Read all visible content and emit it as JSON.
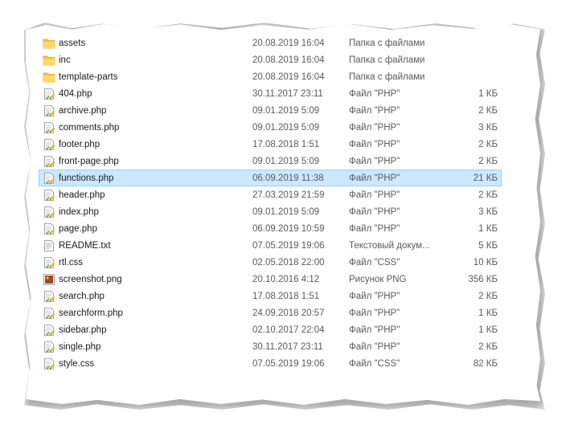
{
  "files": [
    {
      "name": "assets",
      "date": "20.08.2019 16:04",
      "type": "Папка с файлами",
      "size": "",
      "icon": "folder-icon"
    },
    {
      "name": "inc",
      "date": "20.08.2019 16:04",
      "type": "Папка с файлами",
      "size": "",
      "icon": "folder-icon"
    },
    {
      "name": "template-parts",
      "date": "20.08.2019 16:04",
      "type": "Папка с файлами",
      "size": "",
      "icon": "folder-icon"
    },
    {
      "name": "404.php",
      "date": "30.11.2017 23:11",
      "type": "Файл \"PHP\"",
      "size": "1 КБ",
      "icon": "php-file-icon"
    },
    {
      "name": "archive.php",
      "date": "09.01.2019 5:09",
      "type": "Файл \"PHP\"",
      "size": "2 КБ",
      "icon": "php-file-icon"
    },
    {
      "name": "comments.php",
      "date": "09.01.2019 5:09",
      "type": "Файл \"PHP\"",
      "size": "3 КБ",
      "icon": "php-file-icon"
    },
    {
      "name": "footer.php",
      "date": "17.08.2018 1:51",
      "type": "Файл \"PHP\"",
      "size": "2 КБ",
      "icon": "php-file-icon"
    },
    {
      "name": "front-page.php",
      "date": "09.01.2019 5:09",
      "type": "Файл \"PHP\"",
      "size": "2 КБ",
      "icon": "php-file-icon"
    },
    {
      "name": "functions.php",
      "date": "06.09.2019 11:38",
      "type": "Файл \"PHP\"",
      "size": "21 КБ",
      "icon": "php-file-icon",
      "selected": true
    },
    {
      "name": "header.php",
      "date": "27.03.2019 21:59",
      "type": "Файл \"PHP\"",
      "size": "2 КБ",
      "icon": "php-file-icon"
    },
    {
      "name": "index.php",
      "date": "09.01.2019 5:09",
      "type": "Файл \"PHP\"",
      "size": "3 КБ",
      "icon": "php-file-icon"
    },
    {
      "name": "page.php",
      "date": "06.09.2019 10:59",
      "type": "Файл \"PHP\"",
      "size": "1 КБ",
      "icon": "php-file-icon"
    },
    {
      "name": "README.txt",
      "date": "07.05.2019 19:06",
      "type": "Текстовый докум...",
      "size": "5 КБ",
      "icon": "text-file-icon"
    },
    {
      "name": "rtl.css",
      "date": "02.05.2018 22:00",
      "type": "Файл \"CSS\"",
      "size": "10 КБ",
      "icon": "php-file-icon"
    },
    {
      "name": "screenshot.png",
      "date": "20.10.2016 4:12",
      "type": "Рисунок PNG",
      "size": "356 КБ",
      "icon": "image-file-icon"
    },
    {
      "name": "search.php",
      "date": "17.08.2018 1:51",
      "type": "Файл \"PHP\"",
      "size": "2 КБ",
      "icon": "php-file-icon"
    },
    {
      "name": "searchform.php",
      "date": "24.09.2018 20:57",
      "type": "Файл \"PHP\"",
      "size": "1 КБ",
      "icon": "php-file-icon"
    },
    {
      "name": "sidebar.php",
      "date": "02.10.2017 22:04",
      "type": "Файл \"PHP\"",
      "size": "1 КБ",
      "icon": "php-file-icon"
    },
    {
      "name": "single.php",
      "date": "30.11.2017 23:11",
      "type": "Файл \"PHP\"",
      "size": "2 КБ",
      "icon": "php-file-icon"
    },
    {
      "name": "style.css",
      "date": "07.05.2019 19:06",
      "type": "Файл \"CSS\"",
      "size": "82 КБ",
      "icon": "php-file-icon"
    }
  ],
  "colors": {
    "selection_bg": "#cce8ff",
    "selection_border": "#99d1ff",
    "folder": "#f0c24f",
    "text": "#1a1a1a",
    "meta_text": "#5a5a5a"
  }
}
